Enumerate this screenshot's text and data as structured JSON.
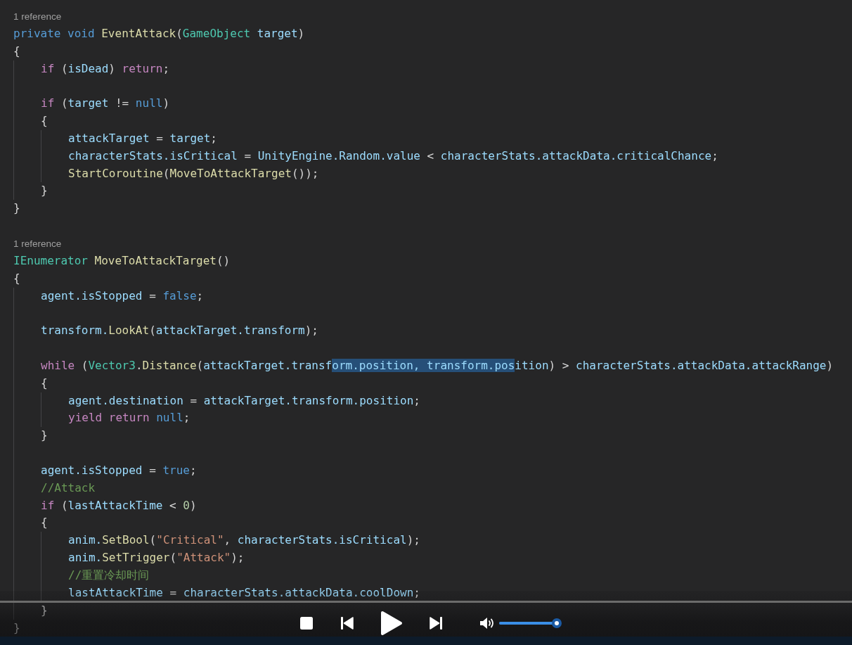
{
  "editor": {
    "lines": [
      {
        "kind": "codelens",
        "text": "1 reference"
      },
      {
        "kind": "code",
        "tokens": [
          {
            "text": "private void ",
            "kind": "storage"
          },
          {
            "text": "EventAttack",
            "kind": "function"
          },
          {
            "text": "(",
            "kind": "punct"
          },
          {
            "text": "GameObject",
            "kind": "type"
          },
          {
            "text": " target",
            "kind": "variable"
          },
          {
            "text": ")",
            "kind": "punct"
          }
        ]
      },
      {
        "kind": "code",
        "tokens": [
          {
            "text": "{",
            "kind": "punct"
          }
        ]
      },
      {
        "kind": "block",
        "children": [
          {
            "kind": "code",
            "tokens": [
              {
                "text": "if",
                "kind": "keyword"
              },
              {
                "text": " (",
                "kind": "punct"
              },
              {
                "text": "isDead",
                "kind": "variable"
              },
              {
                "text": ") ",
                "kind": "punct"
              },
              {
                "text": "return",
                "kind": "keyword"
              },
              {
                "text": ";",
                "kind": "punct"
              }
            ]
          },
          {
            "kind": "blank"
          },
          {
            "kind": "code",
            "tokens": [
              {
                "text": "if",
                "kind": "keyword"
              },
              {
                "text": " (",
                "kind": "punct"
              },
              {
                "text": "target",
                "kind": "variable"
              },
              {
                "text": " != ",
                "kind": "punct"
              },
              {
                "text": "null",
                "kind": "storage"
              },
              {
                "text": ")",
                "kind": "punct"
              }
            ]
          },
          {
            "kind": "code",
            "tokens": [
              {
                "text": "{",
                "kind": "punct"
              }
            ]
          },
          {
            "kind": "block",
            "children": [
              {
                "kind": "code",
                "tokens": [
                  {
                    "text": "attackTarget",
                    "kind": "variable"
                  },
                  {
                    "text": " = ",
                    "kind": "punct"
                  },
                  {
                    "text": "target",
                    "kind": "variable"
                  },
                  {
                    "text": ";",
                    "kind": "punct"
                  }
                ]
              },
              {
                "kind": "code",
                "tokens": [
                  {
                    "text": "characterStats.isCritical",
                    "kind": "variable"
                  },
                  {
                    "text": " = ",
                    "kind": "punct"
                  },
                  {
                    "text": "UnityEngine.Random.value",
                    "kind": "variable"
                  },
                  {
                    "text": " < ",
                    "kind": "punct"
                  },
                  {
                    "text": "characterStats.attackData.criticalChance",
                    "kind": "variable"
                  },
                  {
                    "text": ";",
                    "kind": "punct"
                  }
                ]
              },
              {
                "kind": "code",
                "tokens": [
                  {
                    "text": "StartCoroutine",
                    "kind": "function"
                  },
                  {
                    "text": "(",
                    "kind": "punct"
                  },
                  {
                    "text": "MoveToAttackTarget",
                    "kind": "function"
                  },
                  {
                    "text": "());",
                    "kind": "punct"
                  }
                ]
              }
            ]
          },
          {
            "kind": "code",
            "tokens": [
              {
                "text": "}",
                "kind": "punct"
              }
            ]
          }
        ]
      },
      {
        "kind": "code",
        "tokens": [
          {
            "text": "}",
            "kind": "punct"
          }
        ]
      },
      {
        "kind": "blank"
      },
      {
        "kind": "codelens",
        "text": "1 reference"
      },
      {
        "kind": "code",
        "tokens": [
          {
            "text": "IEnumerator ",
            "kind": "type"
          },
          {
            "text": "MoveToAttackTarget",
            "kind": "function"
          },
          {
            "text": "()",
            "kind": "punct"
          }
        ]
      },
      {
        "kind": "code",
        "tokens": [
          {
            "text": "{",
            "kind": "punct"
          }
        ]
      },
      {
        "kind": "block",
        "children": [
          {
            "kind": "code",
            "tokens": [
              {
                "text": "agent.isStopped",
                "kind": "variable"
              },
              {
                "text": " = ",
                "kind": "punct"
              },
              {
                "text": "false",
                "kind": "storage"
              },
              {
                "text": ";",
                "kind": "punct"
              }
            ]
          },
          {
            "kind": "blank"
          },
          {
            "kind": "code",
            "tokens": [
              {
                "text": "transform.",
                "kind": "variable"
              },
              {
                "text": "LookAt",
                "kind": "function"
              },
              {
                "text": "(",
                "kind": "punct"
              },
              {
                "text": "attackTarget.transform",
                "kind": "variable"
              },
              {
                "text": ");",
                "kind": "punct"
              }
            ]
          },
          {
            "kind": "blank"
          },
          {
            "kind": "code",
            "tokens": [
              {
                "text": "while",
                "kind": "keyword"
              },
              {
                "text": " (",
                "kind": "punct"
              },
              {
                "text": "Vector3",
                "kind": "type"
              },
              {
                "text": ".",
                "kind": "punct"
              },
              {
                "text": "Distance",
                "kind": "function"
              },
              {
                "text": "(",
                "kind": "punct"
              },
              {
                "text": "attackTarget.transf",
                "kind": "variable"
              },
              {
                "text": "orm.position, transform.pos",
                "kind": "selection"
              },
              {
                "text": "ition",
                "kind": "variable"
              },
              {
                "text": ") > ",
                "kind": "punct"
              },
              {
                "text": "characterStats.attackData.attackRange",
                "kind": "variable"
              },
              {
                "text": ")",
                "kind": "punct"
              }
            ]
          },
          {
            "kind": "code",
            "tokens": [
              {
                "text": "{",
                "kind": "punct"
              }
            ]
          },
          {
            "kind": "block",
            "children": [
              {
                "kind": "code",
                "tokens": [
                  {
                    "text": "agent.destination",
                    "kind": "variable"
                  },
                  {
                    "text": " = ",
                    "kind": "punct"
                  },
                  {
                    "text": "attackTarget.transform.position",
                    "kind": "variable"
                  },
                  {
                    "text": ";",
                    "kind": "punct"
                  }
                ]
              },
              {
                "kind": "code",
                "tokens": [
                  {
                    "text": "yield return ",
                    "kind": "keyword"
                  },
                  {
                    "text": "null",
                    "kind": "storage"
                  },
                  {
                    "text": ";",
                    "kind": "punct"
                  }
                ]
              }
            ]
          },
          {
            "kind": "code",
            "tokens": [
              {
                "text": "}",
                "kind": "punct"
              }
            ]
          },
          {
            "kind": "blank"
          },
          {
            "kind": "code",
            "tokens": [
              {
                "text": "agent.isStopped",
                "kind": "variable"
              },
              {
                "text": " = ",
                "kind": "punct"
              },
              {
                "text": "true",
                "kind": "storage"
              },
              {
                "text": ";",
                "kind": "punct"
              }
            ]
          },
          {
            "kind": "code",
            "tokens": [
              {
                "text": "//Attack",
                "kind": "comment"
              }
            ]
          },
          {
            "kind": "code",
            "tokens": [
              {
                "text": "if",
                "kind": "keyword"
              },
              {
                "text": " (",
                "kind": "punct"
              },
              {
                "text": "lastAttackTime",
                "kind": "variable"
              },
              {
                "text": " < ",
                "kind": "punct"
              },
              {
                "text": "0",
                "kind": "number"
              },
              {
                "text": ")",
                "kind": "punct"
              }
            ]
          },
          {
            "kind": "code",
            "tokens": [
              {
                "text": "{",
                "kind": "punct"
              }
            ]
          },
          {
            "kind": "block",
            "children": [
              {
                "kind": "code",
                "tokens": [
                  {
                    "text": "anim.",
                    "kind": "variable"
                  },
                  {
                    "text": "SetBool",
                    "kind": "function"
                  },
                  {
                    "text": "(",
                    "kind": "punct"
                  },
                  {
                    "text": "\"Critical\"",
                    "kind": "string"
                  },
                  {
                    "text": ", ",
                    "kind": "punct"
                  },
                  {
                    "text": "characterStats.isCritical",
                    "kind": "variable"
                  },
                  {
                    "text": ");",
                    "kind": "punct"
                  }
                ]
              },
              {
                "kind": "code",
                "tokens": [
                  {
                    "text": "anim.",
                    "kind": "variable"
                  },
                  {
                    "text": "SetTrigger",
                    "kind": "function"
                  },
                  {
                    "text": "(",
                    "kind": "punct"
                  },
                  {
                    "text": "\"Attack\"",
                    "kind": "string"
                  },
                  {
                    "text": ");",
                    "kind": "punct"
                  }
                ]
              },
              {
                "kind": "code",
                "tokens": [
                  {
                    "text": "//重置冷却时间",
                    "kind": "comment"
                  }
                ]
              },
              {
                "kind": "code",
                "tokens": [
                  {
                    "text": "lastAttackTime",
                    "kind": "variable"
                  },
                  {
                    "text": " = ",
                    "kind": "punct"
                  },
                  {
                    "text": "characterStats.attackData.coolDown",
                    "kind": "variable"
                  },
                  {
                    "text": ";",
                    "kind": "punct"
                  }
                ]
              }
            ]
          },
          {
            "kind": "code",
            "tokens": [
              {
                "text": "}",
                "kind": "punct"
              }
            ]
          }
        ]
      },
      {
        "kind": "code",
        "tokens": [
          {
            "text": "}",
            "kind": "punct"
          }
        ]
      }
    ]
  },
  "player": {
    "volume": {
      "level": 1.0
    }
  }
}
